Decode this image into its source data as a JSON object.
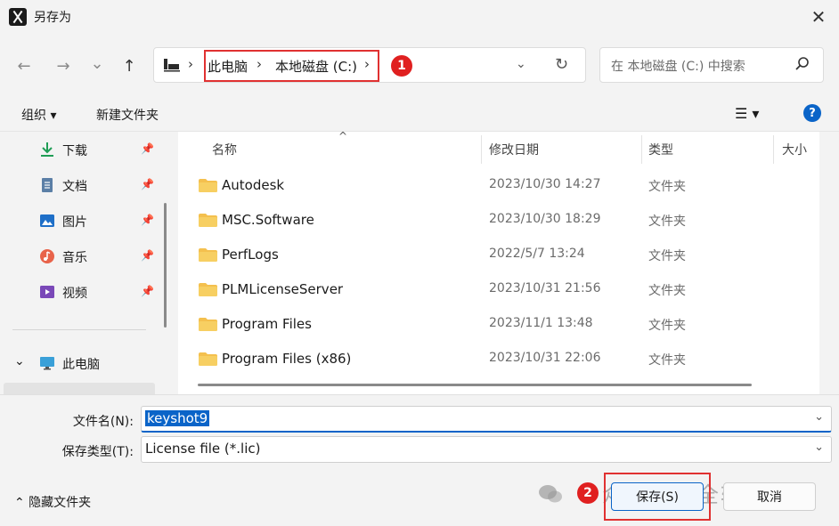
{
  "window": {
    "title": "另存为",
    "close_glyph": "✕"
  },
  "nav": {
    "back_glyph": "←",
    "forward_glyph": "→",
    "recent_glyph": "⌄",
    "up_glyph": "↑",
    "sep_glyph": "›",
    "breadcrumbs": [
      "此电脑",
      "本地磁盘 (C:)"
    ],
    "annotation_1": "1",
    "dropdown_glyph": "⌄",
    "refresh_glyph": "↻"
  },
  "search": {
    "placeholder": "在 本地磁盘 (C:) 中搜索"
  },
  "toolbar": {
    "organize": "组织 ▾",
    "new_folder": "新建文件夹",
    "view": "☰ ▾",
    "help": "?"
  },
  "sidebar": {
    "items": [
      {
        "label": "下载",
        "icon": "download-icon"
      },
      {
        "label": "文档",
        "icon": "document-icon"
      },
      {
        "label": "图片",
        "icon": "picture-icon"
      },
      {
        "label": "音乐",
        "icon": "music-icon"
      },
      {
        "label": "视频",
        "icon": "video-icon"
      }
    ],
    "pin_glyph": "📌",
    "this_pc": "此电脑",
    "expand_glyph": "⌄"
  },
  "columns": {
    "name": "名称",
    "modified": "修改日期",
    "type": "类型",
    "size": "大小",
    "sort_glyph": "^"
  },
  "files": [
    {
      "name": "Autodesk",
      "modified": "2023/10/30 14:27",
      "type": "文件夹"
    },
    {
      "name": "MSC.Software",
      "modified": "2023/10/30 18:29",
      "type": "文件夹"
    },
    {
      "name": "PerfLogs",
      "modified": "2022/5/7 13:24",
      "type": "文件夹"
    },
    {
      "name": "PLMLicenseServer",
      "modified": "2023/10/31 21:56",
      "type": "文件夹"
    },
    {
      "name": "Program Files",
      "modified": "2023/11/1 13:48",
      "type": "文件夹"
    },
    {
      "name": "Program Files (x86)",
      "modified": "2023/10/31 22:06",
      "type": "文件夹"
    }
  ],
  "form": {
    "filename_label": "文件名(N):",
    "filename_value": "keyshot9",
    "filetype_label": "保存类型(T):",
    "filetype_value": "License file (*.lic)",
    "dropdown_glyph": "⌄"
  },
  "footer": {
    "hide_folders": "⌃  隐藏文件夹",
    "annotation_2": "2",
    "save": "保存(S)",
    "cancel": "取消",
    "watermark": "众号 · 最全软件管家"
  },
  "colors": {
    "accent": "#0a64c8",
    "annotation": "#e03131",
    "folder": "#f4c04e"
  }
}
